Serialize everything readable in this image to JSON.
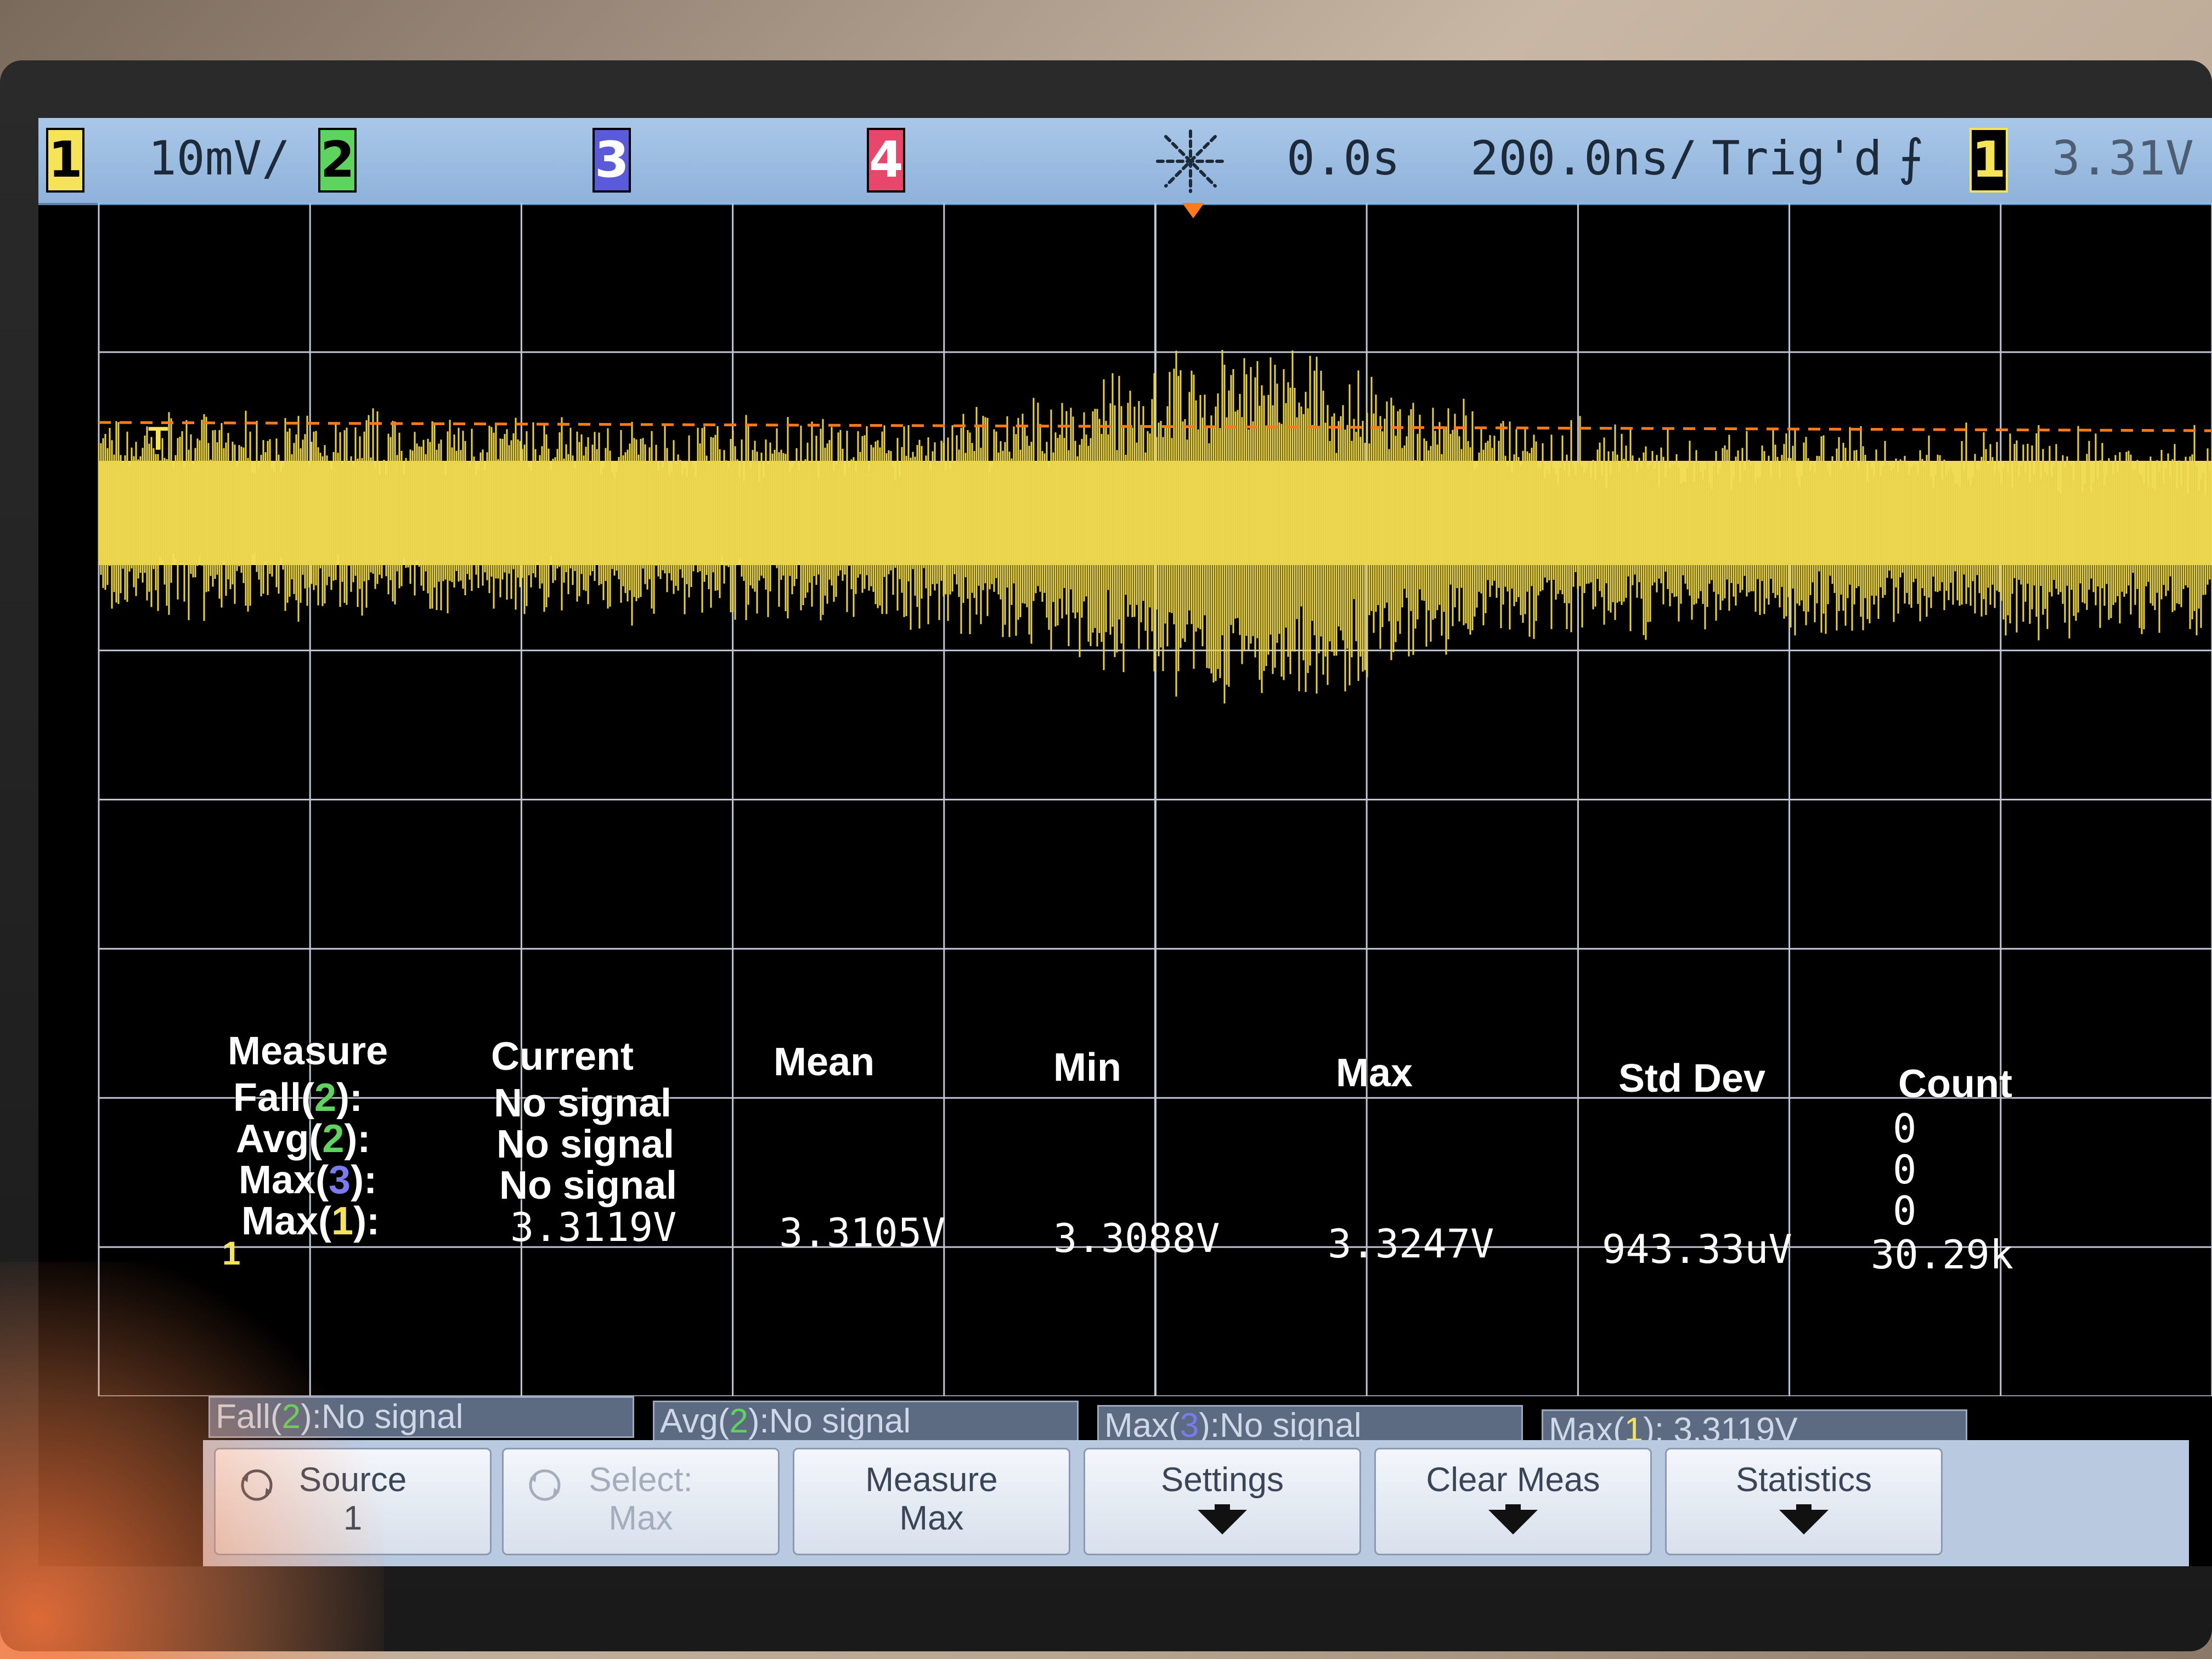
{
  "topbar": {
    "ch1_label": "1",
    "ch1_scale": "10mV/",
    "ch2_label": "2",
    "ch3_label": "3",
    "ch4_label": "4",
    "time_offset": "0.0s",
    "time_scale": "200.0ns/",
    "trig_status": "Trig'd",
    "trig_edge_icon": "rising-edge-icon",
    "trig_channel": "1",
    "trig_level": "3.31V"
  },
  "markers": {
    "ch1_ground": "T",
    "ch1_ref": "1"
  },
  "measure": {
    "headers": {
      "measure": "Measure",
      "current": "Current",
      "mean": "Mean",
      "min": "Min",
      "max": "Max",
      "std_dev": "Std Dev",
      "count": "Count"
    },
    "rows": [
      {
        "name": "Fall(",
        "ch": "2",
        "close": "):",
        "current": "No signal",
        "mean": "",
        "min": "",
        "max": "",
        "std_dev": "",
        "count": "0"
      },
      {
        "name": "Avg(",
        "ch": "2",
        "close": "):",
        "current": "No signal",
        "mean": "",
        "min": "",
        "max": "",
        "std_dev": "",
        "count": "0"
      },
      {
        "name": "Max(",
        "ch": "3",
        "close": "):",
        "current": "No signal",
        "mean": "",
        "min": "",
        "max": "",
        "std_dev": "",
        "count": "0"
      },
      {
        "name": "Max(",
        "ch": "1",
        "close": "):",
        "current": "3.3119V",
        "mean": "3.3105V",
        "min": "3.3088V",
        "max": "3.3247V",
        "std_dev": "943.33uV",
        "count": "30.29k"
      }
    ]
  },
  "status": [
    {
      "name": "Fall(",
      "ch": "2",
      "rest": "):No signal"
    },
    {
      "name": "Avg(",
      "ch": "2",
      "rest": "):No signal"
    },
    {
      "name": "Max(",
      "ch": "3",
      "rest": "):No signal"
    },
    {
      "name": "Max(",
      "ch": "1",
      "rest": "): 3.3119V"
    }
  ],
  "softkeys": {
    "source_l1": "Source",
    "source_l2": "1",
    "select_l1": "Select:",
    "select_l2": "Max",
    "measure_l1": "Measure",
    "measure_l2": "Max",
    "settings": "Settings",
    "clear_meas": "Clear Meas",
    "statistics": "Statistics"
  },
  "colors": {
    "ch1": "#f5e35a",
    "ch2": "#5fd35f",
    "ch3": "#5b5bd9",
    "ch4": "#e8466b",
    "trigger_level": "#ff7a1a"
  }
}
